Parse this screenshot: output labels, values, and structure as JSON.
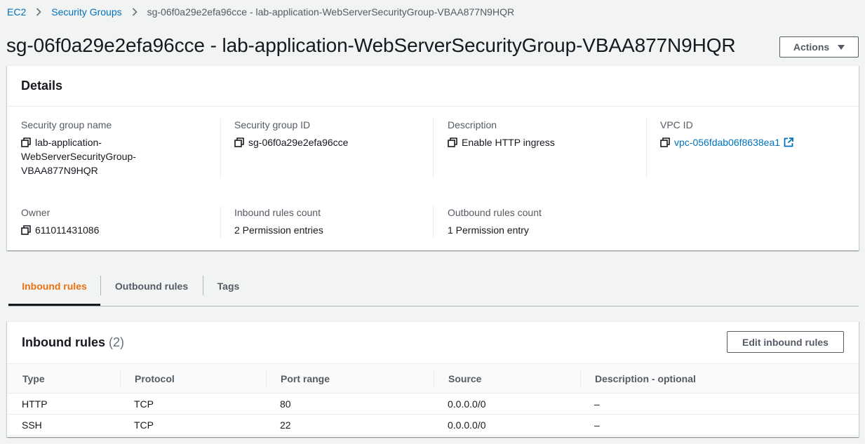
{
  "breadcrumb": {
    "items": [
      "EC2",
      "Security Groups"
    ],
    "current": "sg-06f0a29e2efa96cce - lab-application-WebServerSecurityGroup-VBAA877N9HQR"
  },
  "page": {
    "title": "sg-06f0a29e2efa96cce - lab-application-WebServerSecurityGroup-VBAA877N9HQR",
    "actions_label": "Actions"
  },
  "details": {
    "header": "Details",
    "fields": {
      "sg_name": {
        "label": "Security group name",
        "value_lines": [
          "lab-application-",
          "WebServerSecurityGroup-",
          "VBAA877N9HQR"
        ]
      },
      "sg_id": {
        "label": "Security group ID",
        "value": "sg-06f0a29e2efa96cce"
      },
      "description": {
        "label": "Description",
        "value": "Enable HTTP ingress"
      },
      "vpc_id": {
        "label": "VPC ID",
        "value": "vpc-056fdab06f8638ea1"
      },
      "owner": {
        "label": "Owner",
        "value": "611011431086"
      },
      "inbound_count": {
        "label": "Inbound rules count",
        "value": "2 Permission entries"
      },
      "outbound_count": {
        "label": "Outbound rules count",
        "value": "1 Permission entry"
      }
    }
  },
  "tabs": [
    {
      "label": "Inbound rules",
      "active": true
    },
    {
      "label": "Outbound rules",
      "active": false
    },
    {
      "label": "Tags",
      "active": false
    }
  ],
  "inbound_rules": {
    "title": "Inbound rules",
    "count": "(2)",
    "edit_label": "Edit inbound rules",
    "columns": [
      "Type",
      "Protocol",
      "Port range",
      "Source",
      "Description - optional"
    ],
    "rows": [
      [
        "HTTP",
        "TCP",
        "80",
        "0.0.0.0/0",
        "–"
      ],
      [
        "SSH",
        "TCP",
        "22",
        "0.0.0.0/0",
        "–"
      ]
    ]
  },
  "colors": {
    "link": "#0073bb",
    "active_tab": "#ec7211",
    "text": "#16191f",
    "secondary_text": "#545b64"
  }
}
